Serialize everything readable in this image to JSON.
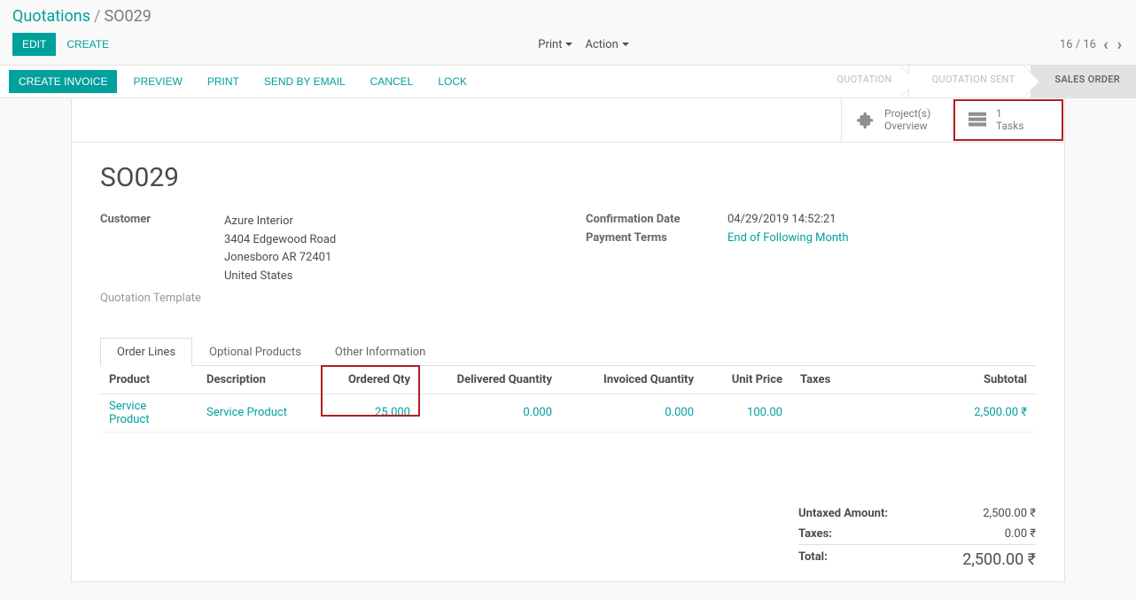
{
  "breadcrumb": {
    "root": "Quotations",
    "current": "SO029"
  },
  "controls": {
    "edit": "EDIT",
    "create": "CREATE",
    "print": "Print",
    "action": "Action"
  },
  "pager": {
    "pos": "16 / 16"
  },
  "statusbar": {
    "create_invoice": "CREATE INVOICE",
    "preview": "PREVIEW",
    "print": "PRINT",
    "send_email": "SEND BY EMAIL",
    "cancel": "CANCEL",
    "lock": "LOCK",
    "steps": {
      "quotation": "QUOTATION",
      "sent": "QUOTATION SENT",
      "order": "SALES ORDER"
    }
  },
  "stat_buttons": {
    "projects_line1": "Project(s)",
    "projects_line2": "Overview",
    "tasks_count": "1",
    "tasks_label": "Tasks"
  },
  "order": {
    "name": "SO029",
    "customer_label": "Customer",
    "customer_name": "Azure Interior",
    "customer_addr1": "3404 Edgewood Road",
    "customer_addr2": "Jonesboro AR 72401",
    "customer_addr3": "United States",
    "template_label": "Quotation Template",
    "confirm_label": "Confirmation Date",
    "confirm_value": "04/29/2019 14:52:21",
    "terms_label": "Payment Terms",
    "terms_value": "End of Following Month"
  },
  "tabs": {
    "lines": "Order Lines",
    "optional": "Optional Products",
    "other": "Other Information"
  },
  "table": {
    "h_product": "Product",
    "h_desc": "Description",
    "h_ord": "Ordered Qty",
    "h_del": "Delivered Quantity",
    "h_inv": "Invoiced Quantity",
    "h_price": "Unit Price",
    "h_tax": "Taxes",
    "h_sub": "Subtotal",
    "rows": [
      {
        "product": "Service Product",
        "desc": "Service Product",
        "ord": "25.000",
        "del": "0.000",
        "inv": "0.000",
        "price": "100.00",
        "tax": "",
        "sub": "2,500.00 ₹"
      }
    ]
  },
  "totals": {
    "untaxed_label": "Untaxed Amount:",
    "untaxed_value": "2,500.00 ₹",
    "taxes_label": "Taxes:",
    "taxes_value": "0.00 ₹",
    "total_label": "Total:",
    "total_value": "2,500.00 ₹"
  }
}
